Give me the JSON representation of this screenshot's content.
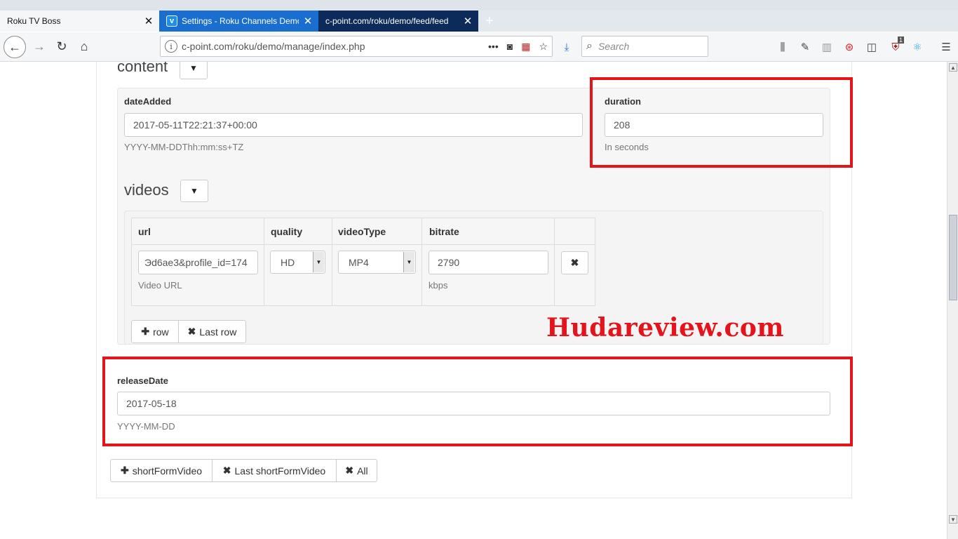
{
  "tabs": [
    {
      "title": "Roku TV Boss"
    },
    {
      "title": "Settings - Roku Channels Demo"
    },
    {
      "title": "c-point.com/roku/demo/feed/feed"
    }
  ],
  "nav": {
    "url": "c-point.com/roku/demo/manage/index.php",
    "search_placeholder": "Search",
    "notification_count": "1"
  },
  "content": {
    "title": "content",
    "dateAdded": {
      "label": "dateAdded",
      "value": "2017-05-11T22:21:37+00:00",
      "help": "YYYY-MM-DDThh:mm:ss+TZ"
    },
    "duration": {
      "label": "duration",
      "value": "208",
      "help": "In seconds"
    }
  },
  "videos": {
    "title": "videos",
    "headers": {
      "url": "url",
      "quality": "quality",
      "videoType": "videoType",
      "bitrate": "bitrate"
    },
    "row": {
      "url": "Эd6ae3&profile_id=174",
      "url_help": "Video URL",
      "quality": "HD",
      "videoType": "MP4",
      "bitrate": "2790",
      "bitrate_help": "kbps"
    },
    "add_row_label": "row",
    "remove_row_label": "Last row"
  },
  "releaseDate": {
    "label": "releaseDate",
    "value": "2017-05-18",
    "help": "YYYY-MM-DD"
  },
  "shortForm": {
    "add_label": "shortFormVideo",
    "remove_last_label": "Last shortFormVideo",
    "remove_all_label": "All"
  },
  "watermark": "Hudareview.com",
  "colors": {
    "highlight": "#e3141b",
    "tab_active": "#1a6ecf"
  }
}
